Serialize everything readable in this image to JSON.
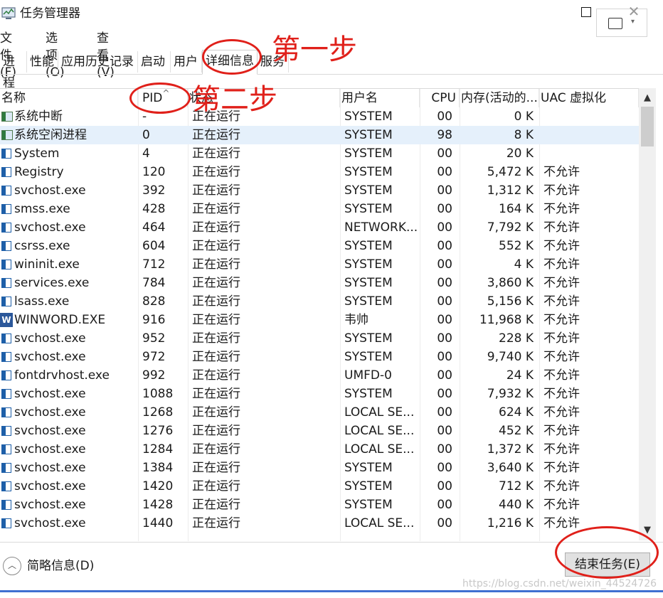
{
  "window": {
    "title": "任务管理器",
    "close_glyph": "✕",
    "thumb_caret": "▾"
  },
  "menu": [
    "文件(F)",
    "选项(O)",
    "查看(V)"
  ],
  "tabs": [
    {
      "label": "进程",
      "active": false
    },
    {
      "label": "性能",
      "active": false
    },
    {
      "label": "应用历史记录",
      "active": false
    },
    {
      "label": "启动",
      "active": false
    },
    {
      "label": "用户",
      "active": false
    },
    {
      "label": "详细信息",
      "active": true
    },
    {
      "label": "服务",
      "active": false
    }
  ],
  "annotations": {
    "step1": "第一步",
    "step2": "第二步"
  },
  "columns": {
    "name": "名称",
    "pid": "PID",
    "sort_indicator": "^",
    "status": "状态",
    "user": "用户名",
    "cpu": "CPU",
    "memory": "内存(活动的...",
    "uac": "UAC 虚拟化"
  },
  "rows": [
    {
      "name": "系统中断",
      "pid": "-",
      "status": "正在运行",
      "user": "SYSTEM",
      "cpu": "00",
      "mem": "0 K",
      "uac": "",
      "icon": "sys"
    },
    {
      "name": "系统空闲进程",
      "pid": "0",
      "status": "正在运行",
      "user": "SYSTEM",
      "cpu": "98",
      "mem": "8 K",
      "uac": "",
      "icon": "sys",
      "selected": true
    },
    {
      "name": "System",
      "pid": "4",
      "status": "正在运行",
      "user": "SYSTEM",
      "cpu": "00",
      "mem": "20 K",
      "uac": "",
      "icon": "app"
    },
    {
      "name": "Registry",
      "pid": "120",
      "status": "正在运行",
      "user": "SYSTEM",
      "cpu": "00",
      "mem": "5,472 K",
      "uac": "不允许",
      "icon": "app"
    },
    {
      "name": "svchost.exe",
      "pid": "392",
      "status": "正在运行",
      "user": "SYSTEM",
      "cpu": "00",
      "mem": "1,312 K",
      "uac": "不允许",
      "icon": "app"
    },
    {
      "name": "smss.exe",
      "pid": "428",
      "status": "正在运行",
      "user": "SYSTEM",
      "cpu": "00",
      "mem": "164 K",
      "uac": "不允许",
      "icon": "app"
    },
    {
      "name": "svchost.exe",
      "pid": "464",
      "status": "正在运行",
      "user": "NETWORK...",
      "cpu": "00",
      "mem": "7,792 K",
      "uac": "不允许",
      "icon": "app"
    },
    {
      "name": "csrss.exe",
      "pid": "604",
      "status": "正在运行",
      "user": "SYSTEM",
      "cpu": "00",
      "mem": "552 K",
      "uac": "不允许",
      "icon": "app"
    },
    {
      "name": "wininit.exe",
      "pid": "712",
      "status": "正在运行",
      "user": "SYSTEM",
      "cpu": "00",
      "mem": "4 K",
      "uac": "不允许",
      "icon": "app"
    },
    {
      "name": "services.exe",
      "pid": "784",
      "status": "正在运行",
      "user": "SYSTEM",
      "cpu": "00",
      "mem": "3,860 K",
      "uac": "不允许",
      "icon": "app"
    },
    {
      "name": "lsass.exe",
      "pid": "828",
      "status": "正在运行",
      "user": "SYSTEM",
      "cpu": "00",
      "mem": "5,156 K",
      "uac": "不允许",
      "icon": "app"
    },
    {
      "name": "WINWORD.EXE",
      "pid": "916",
      "status": "正在运行",
      "user": "韦帅",
      "cpu": "00",
      "mem": "11,968 K",
      "uac": "不允许",
      "icon": "word"
    },
    {
      "name": "svchost.exe",
      "pid": "952",
      "status": "正在运行",
      "user": "SYSTEM",
      "cpu": "00",
      "mem": "228 K",
      "uac": "不允许",
      "icon": "app"
    },
    {
      "name": "svchost.exe",
      "pid": "972",
      "status": "正在运行",
      "user": "SYSTEM",
      "cpu": "00",
      "mem": "9,740 K",
      "uac": "不允许",
      "icon": "app"
    },
    {
      "name": "fontdrvhost.exe",
      "pid": "992",
      "status": "正在运行",
      "user": "UMFD-0",
      "cpu": "00",
      "mem": "24 K",
      "uac": "不允许",
      "icon": "app"
    },
    {
      "name": "svchost.exe",
      "pid": "1088",
      "status": "正在运行",
      "user": "SYSTEM",
      "cpu": "00",
      "mem": "7,932 K",
      "uac": "不允许",
      "icon": "app"
    },
    {
      "name": "svchost.exe",
      "pid": "1268",
      "status": "正在运行",
      "user": "LOCAL SE...",
      "cpu": "00",
      "mem": "624 K",
      "uac": "不允许",
      "icon": "app"
    },
    {
      "name": "svchost.exe",
      "pid": "1276",
      "status": "正在运行",
      "user": "LOCAL SE...",
      "cpu": "00",
      "mem": "452 K",
      "uac": "不允许",
      "icon": "app"
    },
    {
      "name": "svchost.exe",
      "pid": "1284",
      "status": "正在运行",
      "user": "LOCAL SE...",
      "cpu": "00",
      "mem": "1,372 K",
      "uac": "不允许",
      "icon": "app"
    },
    {
      "name": "svchost.exe",
      "pid": "1384",
      "status": "正在运行",
      "user": "SYSTEM",
      "cpu": "00",
      "mem": "3,640 K",
      "uac": "不允许",
      "icon": "app"
    },
    {
      "name": "svchost.exe",
      "pid": "1420",
      "status": "正在运行",
      "user": "SYSTEM",
      "cpu": "00",
      "mem": "712 K",
      "uac": "不允许",
      "icon": "app"
    },
    {
      "name": "svchost.exe",
      "pid": "1428",
      "status": "正在运行",
      "user": "SYSTEM",
      "cpu": "00",
      "mem": "440 K",
      "uac": "不允许",
      "icon": "app"
    },
    {
      "name": "svchost.exe",
      "pid": "1440",
      "status": "正在运行",
      "user": "LOCAL SE...",
      "cpu": "00",
      "mem": "1,216 K",
      "uac": "不允许",
      "icon": "app"
    }
  ],
  "scrollbar": {
    "up": "▲",
    "down": "▼"
  },
  "footer": {
    "less_icon": "︿",
    "less_details": "简略信息(D)",
    "end_task": "结束任务(E)",
    "watermark": "https://blog.csdn.net/weixin_44524726"
  },
  "colors": {
    "annotation": "#e0201a",
    "selection": "#e5f0fb",
    "accent": "#3f6fd0"
  }
}
